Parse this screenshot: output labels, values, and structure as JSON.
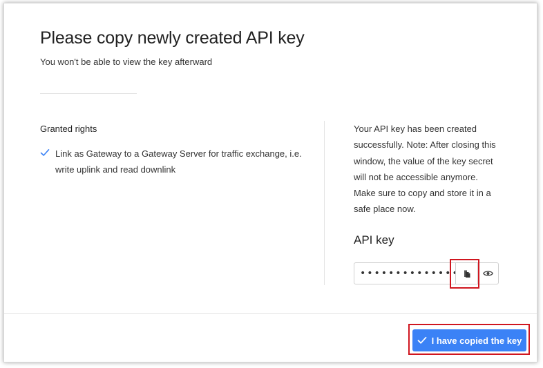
{
  "dialog": {
    "title": "Please copy newly created API key",
    "subtitle": "You won't be able to view the key afterward"
  },
  "rights": {
    "heading": "Granted rights",
    "items": [
      {
        "label": "Link as Gateway to a Gateway Server for traffic exchange, i.e. write uplink and read downlink",
        "icon": "check-icon"
      }
    ]
  },
  "info": {
    "message": "Your API key has been created successfully. Note: After closing this window, the value of the key secret will not be accessible anymore. Make sure to copy and store it in a safe place now."
  },
  "api_key": {
    "label": "API key",
    "masked_value": "••••••••••••••••••••",
    "copy_icon": "copy-icon",
    "toggle_icon": "eye-icon"
  },
  "footer": {
    "confirm_label": "I have copied the key",
    "confirm_icon": "check-icon"
  },
  "colors": {
    "primary": "#3b82f6",
    "check": "#3b82f6",
    "highlight": "#d0161f"
  }
}
